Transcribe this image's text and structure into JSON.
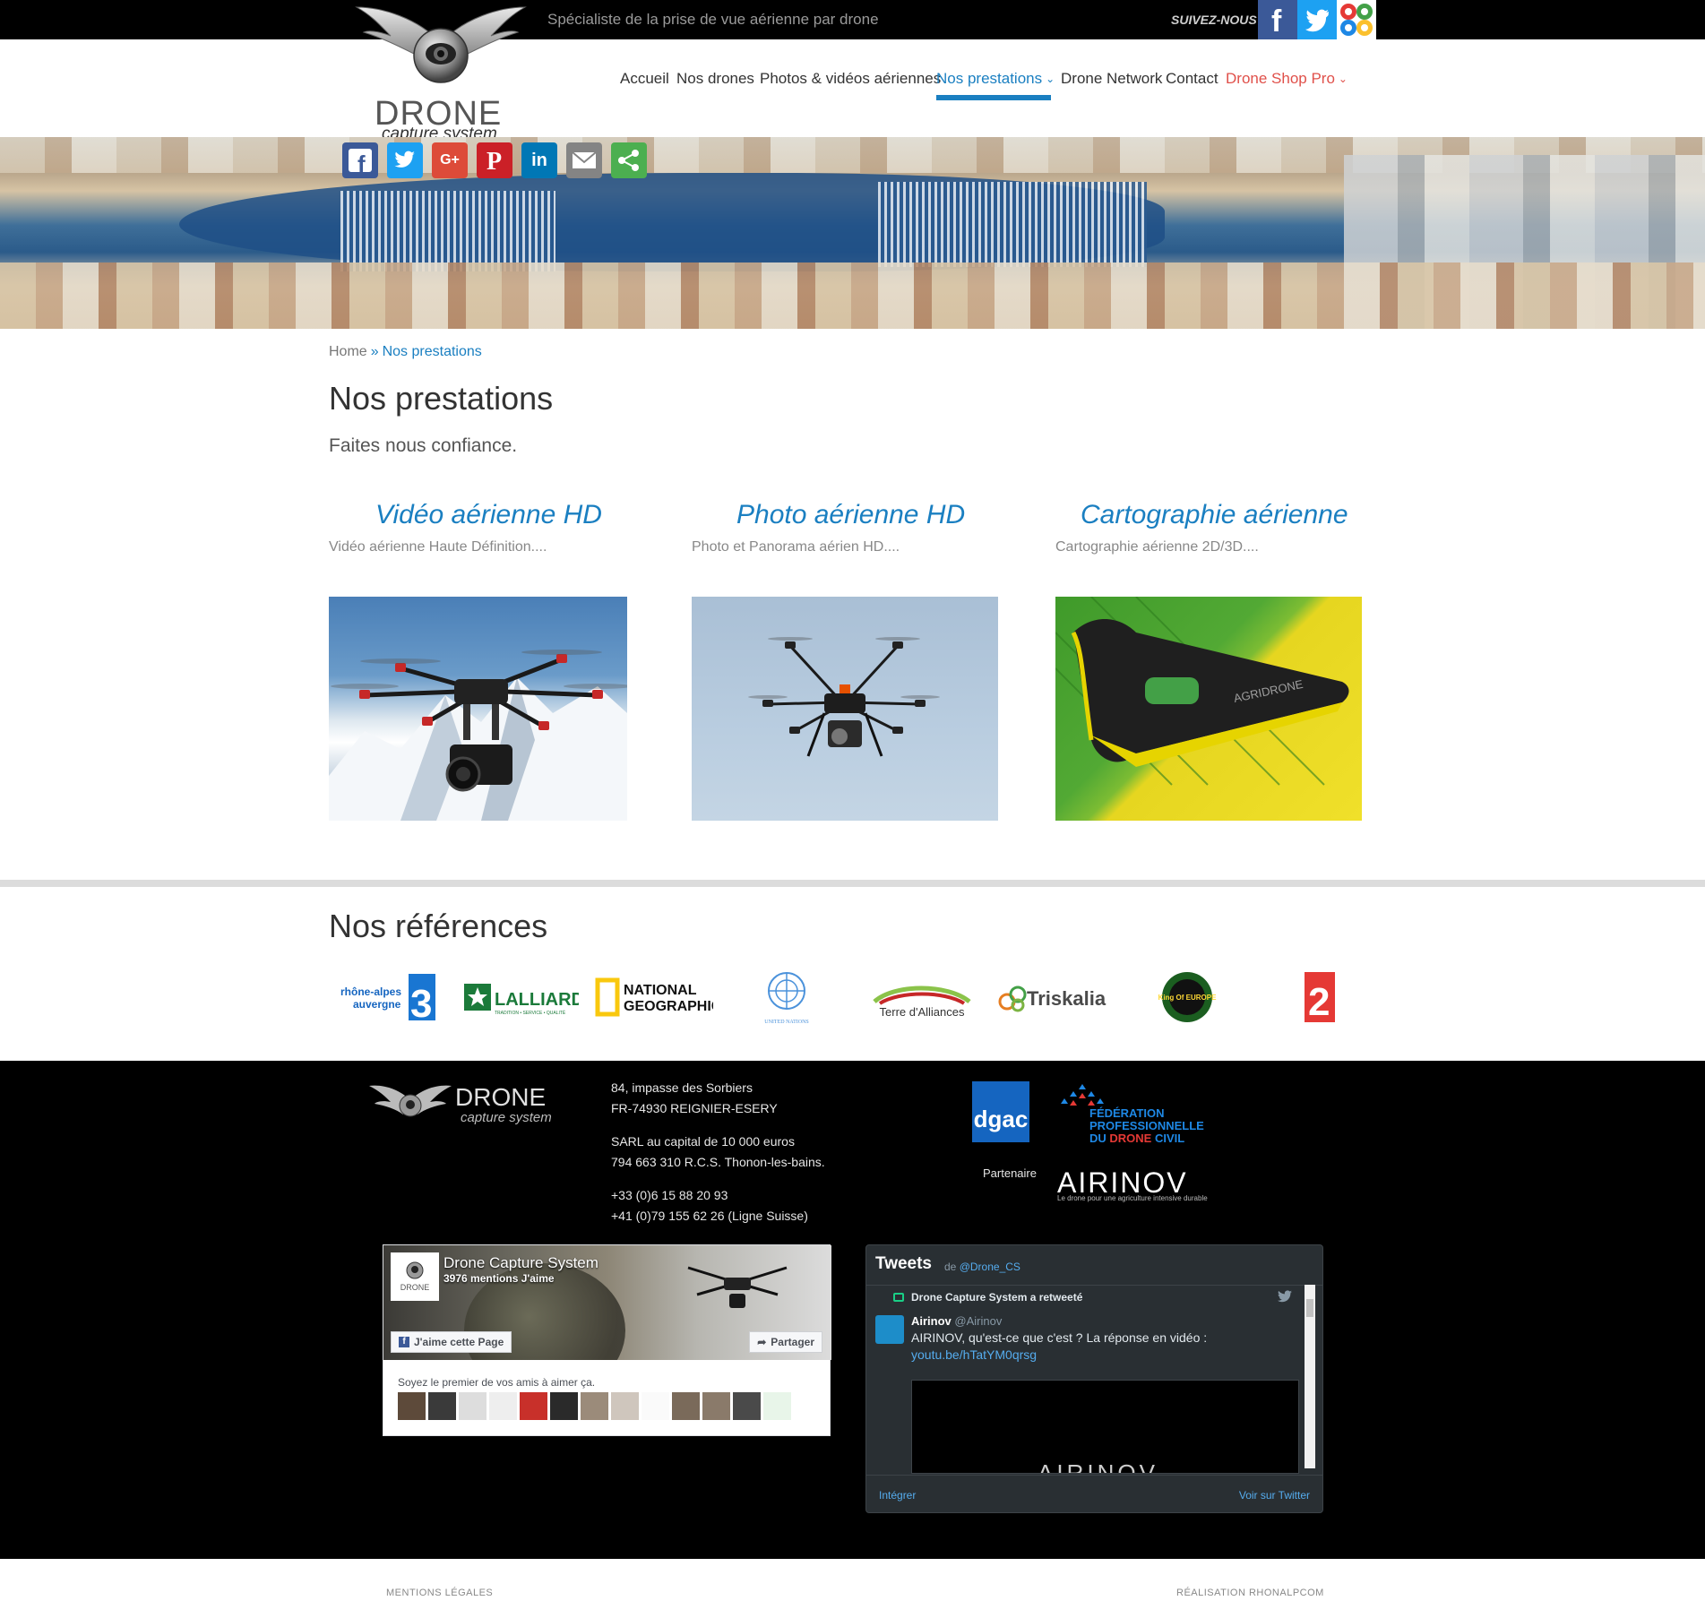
{
  "header": {
    "tagline": "Spécialiste de la prise de vue aérienne par drone",
    "follow_label": "SUIVEZ-NOUS",
    "social_icons": [
      "facebook-icon",
      "twitter-icon",
      "google-plus-icon"
    ]
  },
  "logo": {
    "wordmark": "DRONE",
    "sub": "capture system"
  },
  "nav": {
    "items": [
      {
        "label": "Accueil"
      },
      {
        "label": "Nos drones"
      },
      {
        "label": "Photos & vidéos aériennes"
      },
      {
        "label": "Nos prestations",
        "has_dropdown": true,
        "active": true
      },
      {
        "label": "Drone Network"
      },
      {
        "label": "Contact"
      },
      {
        "label": "Drone Shop Pro",
        "has_dropdown": true
      }
    ],
    "active_color": "#1a7fc1",
    "shop_color": "#e0504a"
  },
  "share": {
    "icons": [
      "facebook-icon",
      "twitter-icon",
      "google-plus-icon",
      "pinterest-icon",
      "linkedin-icon",
      "email-icon",
      "share-more-icon"
    ],
    "gp_label": "G+",
    "li_label": "in"
  },
  "breadcrumb": {
    "home": "Home",
    "sep": "»",
    "current": "Nos prestations"
  },
  "page": {
    "title": "Nos prestations",
    "subtitle": "Faites nous confiance."
  },
  "services": [
    {
      "title": "Vidéo aérienne HD",
      "desc": "Vidéo aérienne Haute Définition...."
    },
    {
      "title": "Photo aérienne HD",
      "desc": "Photo et Panorama aérien HD...."
    },
    {
      "title": "Cartographie aérienne",
      "desc": "Cartographie aérienne 2D/3D...."
    }
  ],
  "references": {
    "title": "Nos références",
    "logos": {
      "france3_line1": "rhône-alpes",
      "france3_line2": "auvergne",
      "france3_badge": "3",
      "lalliard": "LALLIARD",
      "lalliard_sub": "TRADITION • SERVICE • QUALITÉ",
      "natgeo_line1": "NATIONAL",
      "natgeo_line2": "GEOGRAPHIC",
      "un": "UNITED NATIONS",
      "terre": "Terre d'Alliances",
      "triskalia": "Triskalia",
      "king": "King Of EUROPE",
      "france2": "2"
    }
  },
  "footer": {
    "logo_wordmark": "DRONE",
    "logo_sub": "capture system",
    "address_1": "84, impasse des Sorbiers",
    "address_2": "FR-74930 REIGNIER-ESERY",
    "company_1": "SARL au capital de 10 000 euros",
    "company_2": "794 663 310 R.C.S. Thonon-les-bains.",
    "phone_1": "+33 (0)6 15 88 20 93",
    "phone_2": "+41 (0)79 155 62 26 (Ligne Suisse)",
    "dgac": "dgac",
    "federation_1": "FÉDÉRATION",
    "federation_2": "PROFESSIONNELLE",
    "federation_3a": "DU ",
    "federation_3b": "DRONE",
    "federation_3c": " CIVIL",
    "partner_label": "Partenaire",
    "airinov": "AIRINOV",
    "airinov_sub": "Le drone pour une agriculture intensive durable"
  },
  "facebook": {
    "page_name": "Drone Capture System",
    "likes": "3976 mentions J'aime",
    "like_button": "J'aime cette Page",
    "share_button": "Partager",
    "friends_text": "Soyez le premier de vos amis à aimer ça."
  },
  "twitter": {
    "title": "Tweets",
    "by": "de",
    "handle": "@Drone_CS",
    "retweet_line": "Drone Capture System a retweeté",
    "user_name": "Airinov",
    "user_handle": "@Airinov",
    "tweet_text": "AIRINOV, qu'est-ce que c'est ? La réponse en vidéo :",
    "tweet_link": "youtu.be/hTatYM0qrsg",
    "video_word": "AIRINOV",
    "embed": "Intégrer",
    "view_on": "Voir sur Twitter"
  },
  "bottom": {
    "legal": "MENTIONS LÉGALES",
    "credit": "RÉALISATION RHONALPCOM"
  }
}
